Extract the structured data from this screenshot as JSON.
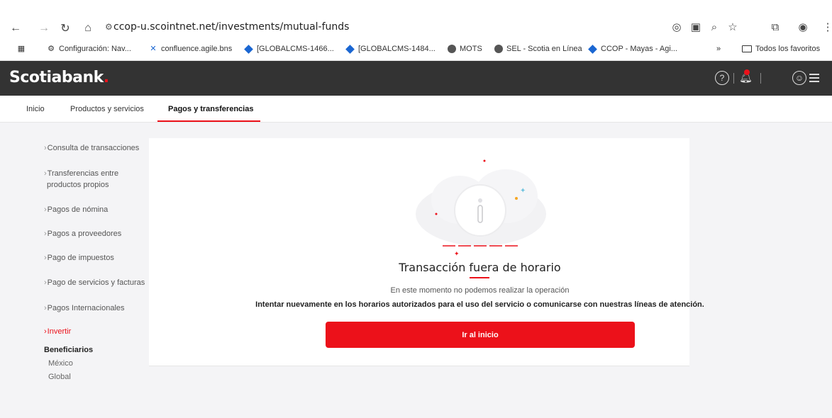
{
  "browser": {
    "url": "ccop-u.scointnet.net/investments/mutual-funds",
    "bookmarks": [
      {
        "label": "Configuración: Nav..."
      },
      {
        "label": "confluence.agile.bns"
      },
      {
        "label": "[GLOBALCMS-1466..."
      },
      {
        "label": "[GLOBALCMS-1484..."
      },
      {
        "label": "MOTS"
      },
      {
        "label": "SEL - Scotia en Línea"
      },
      {
        "label": "CCOP - Mayas - Agi..."
      }
    ],
    "overflow_label": "»",
    "all_bookmarks_label": "Todos los favoritos"
  },
  "header": {
    "logo_text": "Scotiabank",
    "logo_dot": "."
  },
  "topnav": {
    "tabs": [
      {
        "label": "Inicio"
      },
      {
        "label": "Productos y servicios"
      },
      {
        "label": "Pagos y transferencias",
        "active": true
      }
    ]
  },
  "sidebar": {
    "items": [
      {
        "label": "Consulta de transacciones"
      },
      {
        "label": "Transferencias entre"
      },
      {
        "label": "productos propios"
      },
      {
        "label": "Pagos de nómina"
      },
      {
        "label": "Pagos a proveedores"
      },
      {
        "label": "Pago de impuestos"
      },
      {
        "label": "Pago de servicios y facturas"
      },
      {
        "label": "Pagos Internacionales"
      },
      {
        "label": "Invertir",
        "active": true
      }
    ],
    "section_title": "Beneficiarios",
    "section_items": [
      {
        "label": "México"
      },
      {
        "label": "Global"
      }
    ]
  },
  "main": {
    "title": "Transacción fuera de horario",
    "message1": "En este momento no podemos realizar la operación",
    "message2": "Intentar nuevamente en los horarios autorizados para el uso del servicio o comunicarse con nuestras líneas de atención.",
    "button_label": "Ir al inicio"
  },
  "colors": {
    "brand_red": "#ec111a",
    "header_dark": "#333333"
  }
}
